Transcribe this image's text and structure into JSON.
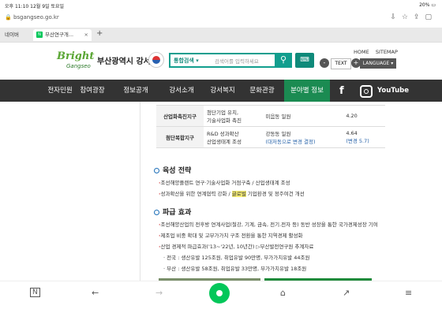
{
  "status_bar": {
    "time_date": "오후 11:10   12월 9일 토요일",
    "battery": "20% ▭"
  },
  "browser": {
    "url": "bsgangseo.go.kr",
    "tabs": [
      {
        "label": "네이버"
      },
      {
        "label": "부산연구개..."
      }
    ]
  },
  "site": {
    "logo_main": "Bright",
    "logo_sub": "Gangseo",
    "city_name": "부산광역시 강서구",
    "search": {
      "scope": "통합검색",
      "placeholder": "검색어를 입력하세요"
    },
    "top_links": [
      "HOME",
      "SITEMAP"
    ],
    "zoom": {
      "minus": "-",
      "label": "TEXT",
      "plus": "+"
    },
    "language": "LANGUAGE ▾",
    "nav": [
      "전자민원",
      "참여광장",
      "정보공개",
      "강서소개",
      "강서복지",
      "문화관광",
      "분야별 정보",
      "YouTube"
    ]
  },
  "table_rows": [
    {
      "name": "산업화촉진지구",
      "strategy": [
        "첨단기업 유치,",
        "기술사업화 촉진"
      ],
      "area": "미음동 일원",
      "area_note": "",
      "value": "4.20",
      "value_note": ""
    },
    {
      "name": "첨단복합지구",
      "strategy": [
        "R&D 성과확산",
        "산업생태계 조성"
      ],
      "area": "강동동 일원",
      "area_note": "(대저동으로 변경 결정)",
      "value": "4.64",
      "value_note": "(변경 5.7)"
    }
  ],
  "section1": {
    "title": "육성 전략",
    "bullets": [
      {
        "text": "조선해양플랜트 연구·기술사업화 거점구축 / 산업생태계 조성"
      },
      {
        "prefix": "성과확산을 위한 연계협력 강화 / ",
        "highlight": "글로벌",
        "suffix": " 기업환경 및 정주여건 개선"
      }
    ]
  },
  "section2": {
    "title": "파급 효과",
    "bullets": [
      "조선해양산업의 전후방 연계사업(철강, 기계, 금속, 전기.전자 등) 동반 성장을 통한 국가경제성장 기여",
      "제조업 비중 확대 및 고부가가치 구조 전환을 통한 지역경제 활성화",
      "산업 경제적 파급효과('13~'22년, 10년간) ▷부산발전연구원 추계자료",
      "· 전국 : 생산유발 125조원, 취업유발 90만명, 부가가치유발 44조원",
      "· 부산 : 생산유발 58조원, 취업유발 33만명, 부가가치유발 18조원"
    ]
  },
  "bottom_bar": [
    "N",
    "←",
    "→",
    "",
    "⌂",
    "↗",
    "≡"
  ]
}
